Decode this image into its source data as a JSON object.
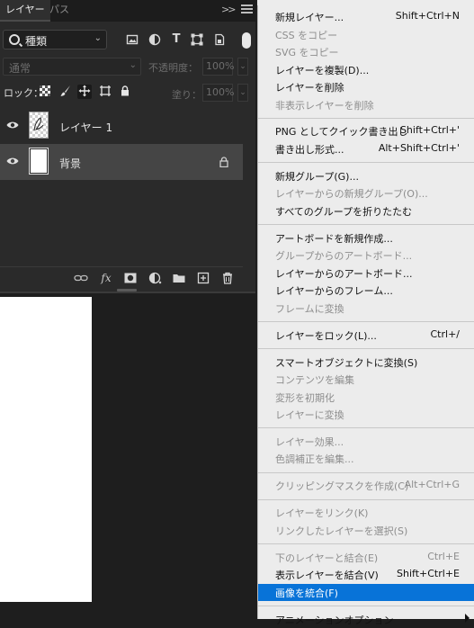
{
  "tabs": {
    "layers": "レイヤー",
    "paths": "パス",
    "collapse": ">>"
  },
  "filter": {
    "kind_label": "種類",
    "icons": [
      "image-filter-icon",
      "adjustment-filter-icon",
      "type-filter-icon",
      "shape-filter-icon",
      "smart-object-filter-icon"
    ]
  },
  "blend": {
    "mode": "通常",
    "opacity_label": "不透明度：",
    "opacity_value": "100%"
  },
  "locks": {
    "label": "ロック：",
    "fill_label": "塗り：",
    "fill_value": "100%"
  },
  "layers": [
    {
      "name": "レイヤー 1",
      "selected": false,
      "locked": false
    },
    {
      "name": "背景",
      "selected": true,
      "locked": true
    }
  ],
  "footer_icons": [
    "link-icon",
    "fx-icon",
    "mask-icon",
    "adjustment-icon",
    "group-folder-icon",
    "new-layer-icon",
    "delete-icon"
  ],
  "menu": [
    {
      "label": "新規レイヤー...",
      "shortcut": "Shift+Ctrl+N",
      "enabled": true
    },
    {
      "label": "CSS をコピー",
      "shortcut": "",
      "enabled": false
    },
    {
      "label": "SVG をコピー",
      "shortcut": "",
      "enabled": false
    },
    {
      "label": "レイヤーを複製(D)...",
      "shortcut": "",
      "enabled": true
    },
    {
      "label": "レイヤーを削除",
      "shortcut": "",
      "enabled": true
    },
    {
      "label": "非表示レイヤーを削除",
      "shortcut": "",
      "enabled": false
    },
    {
      "sep": true
    },
    {
      "label": "PNG としてクイック書き出し",
      "shortcut": "Shift+Ctrl+'",
      "enabled": true
    },
    {
      "label": "書き出し形式...",
      "shortcut": "Alt+Shift+Ctrl+'",
      "enabled": true
    },
    {
      "sep": true
    },
    {
      "label": "新規グループ(G)...",
      "shortcut": "",
      "enabled": true
    },
    {
      "label": "レイヤーからの新規グループ(O)...",
      "shortcut": "",
      "enabled": false
    },
    {
      "label": "すべてのグループを折りたたむ",
      "shortcut": "",
      "enabled": true
    },
    {
      "sep": true
    },
    {
      "label": "アートボードを新規作成...",
      "shortcut": "",
      "enabled": true
    },
    {
      "label": "グループからのアートボード...",
      "shortcut": "",
      "enabled": false
    },
    {
      "label": "レイヤーからのアートボード...",
      "shortcut": "",
      "enabled": true
    },
    {
      "label": "レイヤーからのフレーム...",
      "shortcut": "",
      "enabled": true
    },
    {
      "label": "フレームに変換",
      "shortcut": "",
      "enabled": false
    },
    {
      "sep": true
    },
    {
      "label": "レイヤーをロック(L)...",
      "shortcut": "Ctrl+/",
      "enabled": true
    },
    {
      "sep": true
    },
    {
      "label": "スマートオブジェクトに変換(S)",
      "shortcut": "",
      "enabled": true
    },
    {
      "label": "コンテンツを編集",
      "shortcut": "",
      "enabled": false
    },
    {
      "label": "変形を初期化",
      "shortcut": "",
      "enabled": false
    },
    {
      "label": "レイヤーに変換",
      "shortcut": "",
      "enabled": false
    },
    {
      "sep": true
    },
    {
      "label": "レイヤー効果...",
      "shortcut": "",
      "enabled": false
    },
    {
      "label": "色調補正を編集...",
      "shortcut": "",
      "enabled": false
    },
    {
      "sep": true
    },
    {
      "label": "クリッピングマスクを作成(C)",
      "shortcut": "Alt+Ctrl+G",
      "enabled": false
    },
    {
      "sep": true
    },
    {
      "label": "レイヤーをリンク(K)",
      "shortcut": "",
      "enabled": false
    },
    {
      "label": "リンクしたレイヤーを選択(S)",
      "shortcut": "",
      "enabled": false
    },
    {
      "sep": true
    },
    {
      "label": "下のレイヤーと結合(E)",
      "shortcut": "Ctrl+E",
      "enabled": false
    },
    {
      "label": "表示レイヤーを結合(V)",
      "shortcut": "Shift+Ctrl+E",
      "enabled": true
    },
    {
      "label": "画像を統合(F)",
      "shortcut": "",
      "enabled": true,
      "selected": true
    },
    {
      "sep": true
    },
    {
      "label": "アニメーションオプション",
      "shortcut": "",
      "enabled": true,
      "submenu": true
    }
  ]
}
